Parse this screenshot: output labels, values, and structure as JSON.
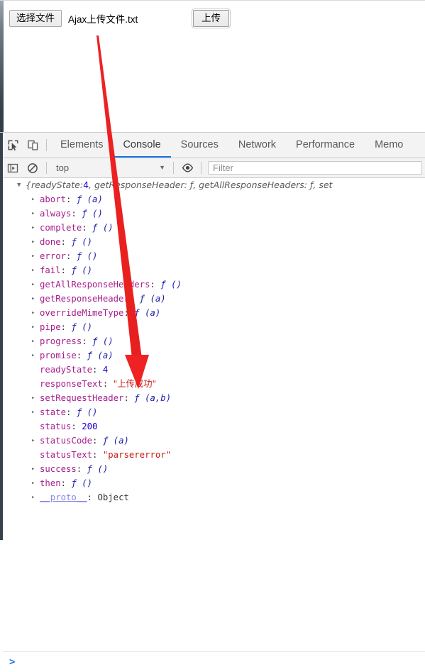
{
  "page": {
    "file_chooser_label": "选择文件",
    "file_name": "Ajax上传文件.txt",
    "upload_button_label": "上传"
  },
  "annotation": {
    "type": "arrow",
    "color": "#ee2222",
    "points_to": "responseText value"
  },
  "devtools": {
    "toolbar_icons": [
      {
        "name": "inspect-element-icon",
        "title": "Inspect"
      },
      {
        "name": "device-toolbar-icon",
        "title": "Toggle device toolbar"
      }
    ],
    "tabs": [
      {
        "label": "Elements",
        "active": false
      },
      {
        "label": "Console",
        "active": true
      },
      {
        "label": "Sources",
        "active": false
      },
      {
        "label": "Network",
        "active": false
      },
      {
        "label": "Performance",
        "active": false
      },
      {
        "label": "Memo",
        "active": false
      }
    ],
    "filterbar": {
      "sidebar_icon": "console-sidebar-icon",
      "clear_icon": "clear-console-icon",
      "context": "top",
      "caret": "▼",
      "eye_icon": "live-expression-eye-icon",
      "filter_placeholder": "Filter",
      "filter_value": ""
    },
    "prompt": {
      "caret": ">",
      "value": ""
    },
    "accent_color": "#1a73e8",
    "console": {
      "header": {
        "triangle": "▼",
        "text_before_num": "{readyState: ",
        "num": "4",
        "text_after_num": ", getResponseHeader: ƒ, getAllResponseHeaders: ƒ, set"
      },
      "rows": [
        {
          "triangle": "▸",
          "name": "abort",
          "value": "ƒ (a)",
          "vtype": "fn"
        },
        {
          "triangle": "▸",
          "name": "always",
          "value": "ƒ ()",
          "vtype": "fn"
        },
        {
          "triangle": "▸",
          "name": "complete",
          "value": "ƒ ()",
          "vtype": "fn"
        },
        {
          "triangle": "▸",
          "name": "done",
          "value": "ƒ ()",
          "vtype": "fn"
        },
        {
          "triangle": "▸",
          "name": "error",
          "value": "ƒ ()",
          "vtype": "fn"
        },
        {
          "triangle": "▸",
          "name": "fail",
          "value": "ƒ ()",
          "vtype": "fn"
        },
        {
          "triangle": "▸",
          "name": "getAllResponseHeaders",
          "value": "ƒ ()",
          "vtype": "fn"
        },
        {
          "triangle": "▸",
          "name": "getResponseHeader",
          "value": "ƒ (a)",
          "vtype": "fn"
        },
        {
          "triangle": "▸",
          "name": "overrideMimeType",
          "value": "ƒ (a)",
          "vtype": "fn"
        },
        {
          "triangle": "▸",
          "name": "pipe",
          "value": "ƒ ()",
          "vtype": "fn"
        },
        {
          "triangle": "▸",
          "name": "progress",
          "value": "ƒ ()",
          "vtype": "fn"
        },
        {
          "triangle": "▸",
          "name": "promise",
          "value": "ƒ (a)",
          "vtype": "fn"
        },
        {
          "triangle": "",
          "name": "readyState",
          "value": "4",
          "vtype": "num"
        },
        {
          "triangle": "",
          "name": "responseText",
          "value": "\"上传成功\"",
          "vtype": "cn"
        },
        {
          "triangle": "▸",
          "name": "setRequestHeader",
          "value": "ƒ (a,b)",
          "vtype": "fn"
        },
        {
          "triangle": "▸",
          "name": "state",
          "value": "ƒ ()",
          "vtype": "fn"
        },
        {
          "triangle": "",
          "name": "status",
          "value": "200",
          "vtype": "num"
        },
        {
          "triangle": "▸",
          "name": "statusCode",
          "value": "ƒ (a)",
          "vtype": "fn"
        },
        {
          "triangle": "",
          "name": "statusText",
          "value": "\"parsererror\"",
          "vtype": "str"
        },
        {
          "triangle": "▸",
          "name": "success",
          "value": "ƒ ()",
          "vtype": "fn"
        },
        {
          "triangle": "▸",
          "name": "then",
          "value": "ƒ ()",
          "vtype": "fn"
        },
        {
          "triangle": "▸",
          "name": "__proto__",
          "value": "Object",
          "vtype": "obj",
          "underline": true
        }
      ]
    }
  }
}
